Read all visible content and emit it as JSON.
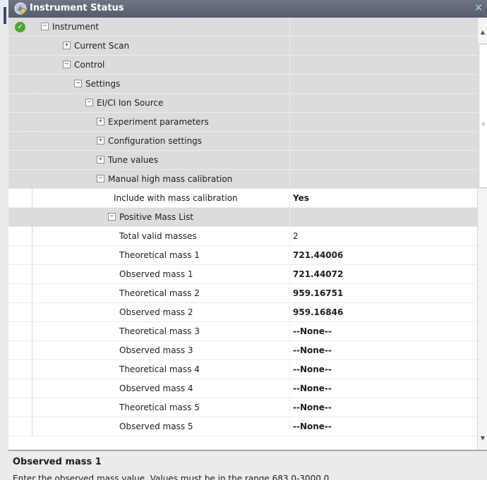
{
  "window": {
    "title": "Instrument Status",
    "close_glyph": "×"
  },
  "tree": {
    "rows": [
      {
        "label": "Instrument",
        "value": "",
        "expander": "−",
        "status": "ok"
      },
      {
        "label": "Current Scan",
        "value": "",
        "expander": "+"
      },
      {
        "label": "Control",
        "value": "",
        "expander": "−"
      },
      {
        "label": "Settings",
        "value": "",
        "expander": "−"
      },
      {
        "label": "EI/CI Ion Source",
        "value": "",
        "expander": "−"
      },
      {
        "label": "Experiment parameters",
        "value": "",
        "expander": "+"
      },
      {
        "label": "Configuration settings",
        "value": "",
        "expander": "+"
      },
      {
        "label": "Tune values",
        "value": "",
        "expander": "+"
      },
      {
        "label": "Manual high mass calibration",
        "value": "",
        "expander": "−"
      },
      {
        "label": "Include with mass calibration",
        "value": "Yes"
      },
      {
        "label": "Positive Mass List",
        "value": "",
        "expander": "−"
      },
      {
        "label": "Total valid masses",
        "value": "2"
      },
      {
        "label": "Theoretical mass 1",
        "value": "721.44006"
      },
      {
        "label": "Observed mass 1",
        "value": "721.44072"
      },
      {
        "label": "Theoretical mass 2",
        "value": "959.16751"
      },
      {
        "label": "Observed mass 2",
        "value": "959.16846"
      },
      {
        "label": "Theoretical mass 3",
        "value": "--None--"
      },
      {
        "label": "Observed mass 3",
        "value": "--None--"
      },
      {
        "label": "Theoretical mass 4",
        "value": "--None--"
      },
      {
        "label": "Observed mass 4",
        "value": "--None--"
      },
      {
        "label": "Theoretical mass 5",
        "value": "--None--"
      },
      {
        "label": "Observed mass 5",
        "value": "--None--"
      }
    ]
  },
  "description": {
    "title": "Observed mass 1",
    "text": "Enter the observed mass value.  Values must be in the range 683.0-3000.0"
  },
  "icons": {
    "panel": "instrument-status-icon",
    "status_ok": "checkmark-icon",
    "scroll_up": "scroll-up-arrow-icon",
    "scroll_down": "scroll-down-arrow-icon"
  },
  "colors": {
    "title_bar": "#5f6774",
    "category_row": "#dcdcdc",
    "ok_green": "#4ea632"
  }
}
